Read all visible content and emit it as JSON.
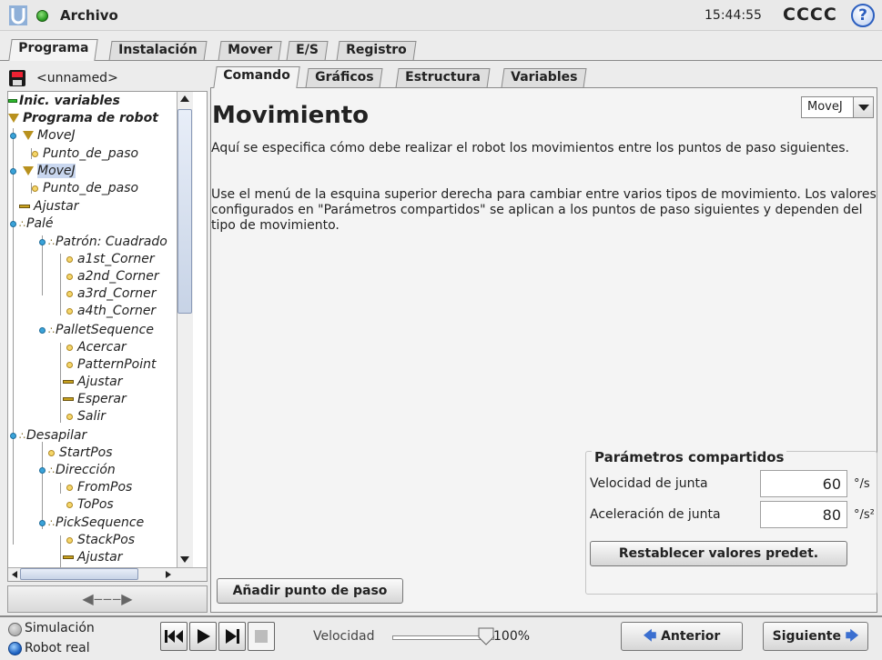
{
  "topbar": {
    "file_menu": "Archivo",
    "clock": "15:44:55",
    "robot_name": "CCCC",
    "help": "?"
  },
  "main_tabs": [
    "Programa",
    "Instalación",
    "Mover",
    "E/S",
    "Registro"
  ],
  "program": {
    "name": "<unnamed>"
  },
  "tree": [
    "Inic. variables",
    "Programa de robot",
    "MoveJ",
    "Punto_de_paso",
    "MoveJ",
    "Punto_de_paso",
    "Ajustar",
    "Palé",
    "Patrón: Cuadrado",
    "a1st_Corner",
    "a2nd_Corner",
    "a3rd_Corner",
    "a4th_Corner",
    "PalletSequence",
    "Acercar",
    "PatternPoint",
    "Ajustar",
    "Esperar",
    "Salir",
    "Desapilar",
    "StartPos",
    "Dirección",
    "FromPos",
    "ToPos",
    "PickSequence",
    "StackPos",
    "Ajustar"
  ],
  "sub_tabs": [
    "Comando",
    "Gráficos",
    "Estructura",
    "Variables"
  ],
  "command": {
    "title": "Movimiento",
    "move_type": "MoveJ",
    "desc1": "Aquí se especifica cómo debe realizar el robot los movimientos entre los puntos de paso siguientes.",
    "desc2": "Use el menú de la esquina superior derecha para cambiar entre varios tipos de movimiento. Los valores configurados en \"Parámetros compartidos\" se aplican a los puntos de paso siguientes y dependen del tipo de movimiento.",
    "add_waypoint": "Añadir punto de paso"
  },
  "shared_params": {
    "legend": "Parámetros compartidos",
    "speed_label": "Velocidad de junta",
    "speed_value": "60",
    "speed_unit": "°/s",
    "accel_label": "Aceleración de junta",
    "accel_value": "80",
    "accel_unit": "°/s²",
    "reset": "Restablecer valores predet."
  },
  "footer": {
    "sim": "Simulación",
    "real": "Robot real",
    "speed_label": "Velocidad",
    "speed_value": "100%",
    "speed_fraction": 1.0,
    "prev": "Anterior",
    "next": "Siguiente"
  },
  "colors": {
    "accent_blue": "#2c5fbf",
    "status_green": "#2a9c22",
    "selection": "#c9d7ef"
  },
  "icons": {
    "logo": "ur-logo-icon",
    "help": "help-icon",
    "save": "save-icon"
  }
}
